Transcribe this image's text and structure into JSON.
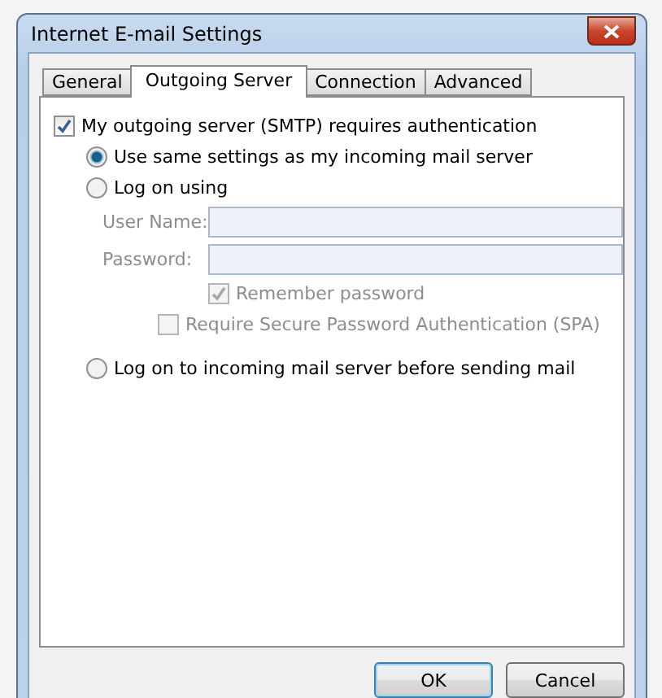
{
  "window": {
    "title": "Internet E-mail Settings"
  },
  "tabs": [
    {
      "label": "General",
      "selected": false
    },
    {
      "label": "Outgoing Server",
      "selected": true
    },
    {
      "label": "Connection",
      "selected": false
    },
    {
      "label": "Advanced",
      "selected": false
    }
  ],
  "requires_auth": {
    "label": "My outgoing server (SMTP) requires authentication",
    "checked": true
  },
  "auth_methods": [
    {
      "label": "Use same settings as my incoming mail server",
      "selected": true
    },
    {
      "label": "Log on using",
      "selected": false
    }
  ],
  "fields": [
    {
      "label": "User Name:",
      "disabled": true
    },
    {
      "label": "Password:",
      "disabled": true
    }
  ],
  "remember_password": {
    "label": "Remember password",
    "checked": true,
    "disabled": true
  },
  "spa": {
    "label": "Require Secure Password Authentication (SPA)",
    "checked": false,
    "disabled": true
  },
  "pre_send_logon": {
    "label": "Log on to incoming mail server before sending mail",
    "selected": false
  },
  "buttons": [
    {
      "label": "OK",
      "default": true
    },
    {
      "label": "Cancel",
      "default": false
    }
  ]
}
